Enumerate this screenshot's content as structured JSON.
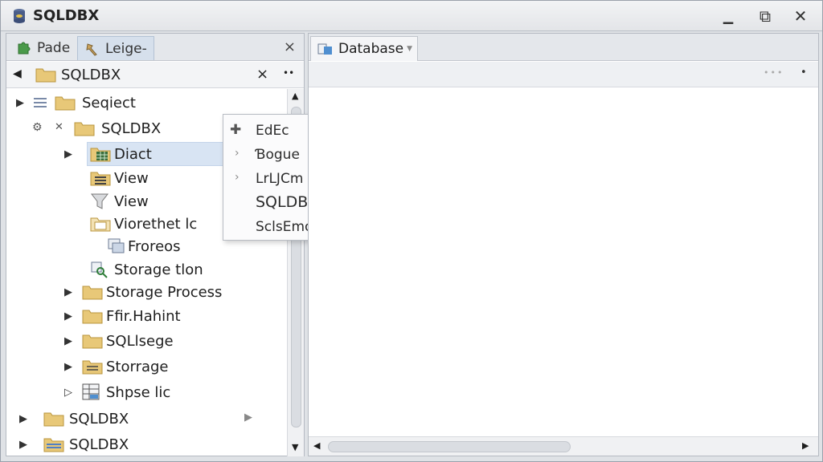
{
  "window": {
    "title": "SQLDBX",
    "controls": [
      "▁",
      "⧉",
      "✕"
    ]
  },
  "left_panel": {
    "tabs": [
      {
        "label": "Pade",
        "icon": "puzzle-icon"
      },
      {
        "label": "Leige-",
        "icon": "hammer-icon",
        "active": true
      }
    ],
    "close_label": "×",
    "path": {
      "label": "SQLDBX",
      "close": "×",
      "more": "••"
    },
    "tree": [
      {
        "label": "Seqiect",
        "level": 0,
        "arrow": "▶"
      },
      {
        "label": "SQLDBX",
        "level": 1,
        "arrow": ""
      },
      {
        "label": "Diact",
        "level": 2,
        "arrow": "▶",
        "selected": true
      },
      {
        "label": "View",
        "level": 2,
        "arrow": ""
      },
      {
        "label": "View",
        "level": 2,
        "arrow": ""
      },
      {
        "label": "Viorethet lc",
        "level": 2,
        "arrow": ""
      },
      {
        "label": "Froreos",
        "level": 3,
        "arrow": ""
      },
      {
        "label": "Storage tlon",
        "level": 2,
        "arrow": ""
      },
      {
        "label": "Storage Process",
        "level": 2,
        "arrow": "▶"
      },
      {
        "label": "Ffir.Hahint",
        "level": 2,
        "arrow": "▶"
      },
      {
        "label": "SQLlsege",
        "level": 2,
        "arrow": "▶"
      },
      {
        "label": "Storrage",
        "level": 2,
        "arrow": "▶"
      },
      {
        "label": "Shpse lic",
        "level": 2,
        "arrow": "▷"
      },
      {
        "label": "SQLDBX",
        "level": 0,
        "arrow": "▶"
      },
      {
        "label": "SQLDBX",
        "level": 0,
        "arrow": "▶"
      }
    ]
  },
  "context_menu": {
    "items": [
      "EdEc",
      "Ɓogue",
      "LrLJCm",
      "SQLDBX",
      "SclsEmo"
    ]
  },
  "right_panel": {
    "tab_label": "Database",
    "toolbar_dots": "•••",
    "toolbar_dot": "•"
  },
  "colors": {
    "selection": "#d8e4f3",
    "folder": "#e8c878",
    "folder_edge": "#b8943c",
    "panel_bg": "#ffffff"
  }
}
